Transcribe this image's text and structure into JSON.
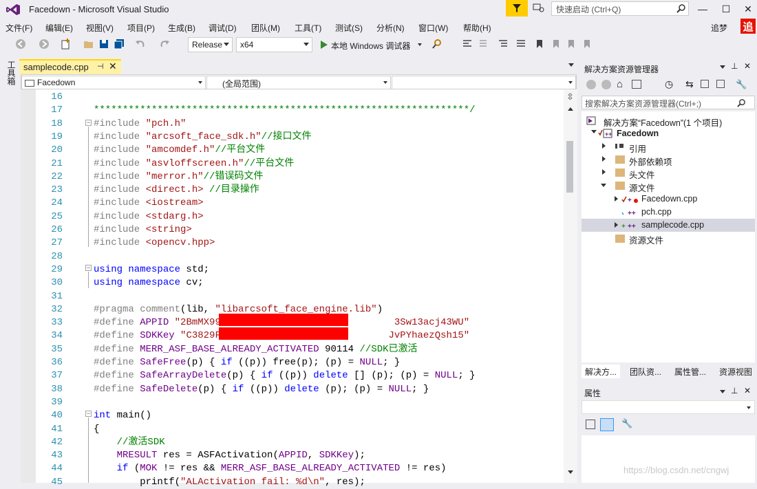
{
  "window": {
    "title": "Facedown - Microsoft Visual Studio",
    "quick_launch_placeholder": "快速启动 (Ctrl+Q)",
    "controls": [
      "—",
      "☐",
      "✕"
    ]
  },
  "menu": [
    "文件(F)",
    "编辑(E)",
    "视图(V)",
    "项目(P)",
    "生成(B)",
    "调试(D)",
    "团队(M)",
    "工具(T)",
    "测试(S)",
    "分析(N)",
    "窗口(W)",
    "帮助(H)"
  ],
  "user": {
    "name": "追梦",
    "badge": "追"
  },
  "toolbar": {
    "config": "Release",
    "platform": "x64",
    "run_label": "本地 Windows 调试器"
  },
  "left_dock": {
    "toolbox": "工具箱"
  },
  "editor": {
    "tab": {
      "name": "samplecode.cpp",
      "pin": "⊣",
      "close": "✕"
    },
    "nav": {
      "project": "Facedown",
      "scope": "(全局范围)",
      "member": ""
    },
    "lines": [
      {
        "n": "16",
        "html": ""
      },
      {
        "n": "17",
        "html": "<span class='cm'>*****************************************************************/</span>"
      },
      {
        "n": "18",
        "html": "<span class='pp'>#include</span> <span class='str'>\"pch.h\"</span>"
      },
      {
        "n": "19",
        "html": "<span class='pp'>#include</span> <span class='str'>\"arcsoft_face_sdk.h\"</span><span class='cm'>//接口文件</span>"
      },
      {
        "n": "20",
        "html": "<span class='pp'>#include</span> <span class='str'>\"amcomdef.h\"</span><span class='cm'>//平台文件</span>"
      },
      {
        "n": "21",
        "html": "<span class='pp'>#include</span> <span class='str'>\"asvloffscreen.h\"</span><span class='cm'>//平台文件</span>"
      },
      {
        "n": "22",
        "html": "<span class='pp'>#include</span> <span class='str'>\"merror.h\"</span><span class='cm'>//错误码文件</span>"
      },
      {
        "n": "23",
        "html": "<span class='pp'>#include</span> <span class='str'>&lt;direct.h&gt;</span> <span class='cm'>//目录操作</span>"
      },
      {
        "n": "24",
        "html": "<span class='pp'>#include</span> <span class='str'>&lt;iostream&gt;</span>"
      },
      {
        "n": "25",
        "html": "<span class='pp'>#include</span> <span class='str'>&lt;stdarg.h&gt;</span>"
      },
      {
        "n": "26",
        "html": "<span class='pp'>#include</span> <span class='str'>&lt;string&gt;</span>"
      },
      {
        "n": "27",
        "html": "<span class='pp'>#include</span> <span class='str'>&lt;opencv.hpp&gt;</span>"
      },
      {
        "n": "28",
        "html": ""
      },
      {
        "n": "29",
        "html": "<span class='kw'>using namespace</span> std;"
      },
      {
        "n": "30",
        "html": "<span class='kw'>using namespace</span> cv;"
      },
      {
        "n": "31",
        "html": ""
      },
      {
        "n": "32",
        "html": "<span class='pp'>#pragma comment</span>(lib, <span class='str'>\"libarcsoft_face_engine.lib\"</span>)"
      },
      {
        "n": "33",
        "html": "<span class='pp'>#define</span> <span class='mac'>APPID</span> <span class='str'>\"2BmMX99F                             3Sw13acj43WU\"</span>"
      },
      {
        "n": "34",
        "html": "<span class='pp'>#define</span> <span class='mac'>SDKKey</span> <span class='str'>\"C3829Fv                            JvPYhaezQsh15\"</span>"
      },
      {
        "n": "35",
        "html": "<span class='pp'>#define</span> <span class='mac'>MERR_ASF_BASE_ALREADY_ACTIVATED</span> 90114 <span class='cm'>//SDK已激活</span>"
      },
      {
        "n": "36",
        "html": "<span class='pp'>#define</span> <span class='mac'>SafeFree</span>(p) { <span class='kw'>if</span> ((p)) free(p); (p) = <span class='mac'>NULL</span>; }"
      },
      {
        "n": "37",
        "html": "<span class='pp'>#define</span> <span class='mac'>SafeArrayDelete</span>(p) { <span class='kw'>if</span> ((p)) <span class='kw'>delete</span> [] (p); (p) = <span class='mac'>NULL</span>; }"
      },
      {
        "n": "38",
        "html": "<span class='pp'>#define</span> <span class='mac'>SafeDelete</span>(p) { <span class='kw'>if</span> ((p)) <span class='kw'>delete</span> (p); (p) = <span class='mac'>NULL</span>; }"
      },
      {
        "n": "39",
        "html": ""
      },
      {
        "n": "40",
        "html": "<span class='kw'>int</span> main()"
      },
      {
        "n": "41",
        "html": "{"
      },
      {
        "n": "42",
        "html": "    <span class='cm'>//激活SDK</span>"
      },
      {
        "n": "43",
        "html": "    <span class='mac'>MRESULT</span> res = ASFActivation(<span class='mac'>APPID</span>, <span class='mac'>SDKKey</span>);"
      },
      {
        "n": "44",
        "html": "    <span class='kw'>if</span> (<span class='mac'>MOK</span> != res &amp;&amp; <span class='mac'>MERR_ASF_BASE_ALREADY_ACTIVATED</span> != res)"
      },
      {
        "n": "45",
        "html": "        printf(<span class='str'>\"ALActivation fail: %d\\n\"</span>, res);"
      }
    ]
  },
  "solution_explorer": {
    "title": "解决方案资源管理器",
    "search_placeholder": "搜索解决方案资源管理器(Ctrl+;)",
    "items": {
      "solution": "解决方案“Facedown”(1 个项目)",
      "project": "Facedown",
      "references": "引用",
      "external": "外部依赖项",
      "headers": "头文件",
      "sources": "源文件",
      "file1": "Facedown.cpp",
      "file2": "pch.cpp",
      "file3": "samplecode.cpp",
      "resources": "资源文件"
    },
    "bottom_tabs": [
      "解决方...",
      "团队资...",
      "属性管...",
      "资源视图"
    ]
  },
  "properties": {
    "title": "属性"
  },
  "watermark": "https://blog.csdn.net/cngwj"
}
